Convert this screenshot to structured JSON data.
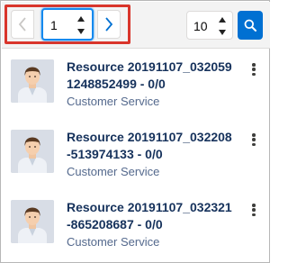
{
  "pagination": {
    "prev_icon": "chevron-left-icon",
    "next_icon": "chevron-right-icon",
    "current_page": "1",
    "page_size": "10",
    "search_icon": "search-icon"
  },
  "colors": {
    "highlight": "#d9352b",
    "brand": "#0070d2",
    "title": "#16325c",
    "subtitle": "#54698d"
  },
  "items": [
    {
      "title": "Resource 20191107_032059 1248852499 - 0/0",
      "subtitle": "Customer Service",
      "avatar_icon": "user-avatar-icon",
      "menu_icon": "kebab-menu-icon"
    },
    {
      "title": "Resource 20191107_032208 -513974133 - 0/0",
      "subtitle": "Customer Service",
      "avatar_icon": "user-avatar-icon",
      "menu_icon": "kebab-menu-icon"
    },
    {
      "title": "Resource 20191107_032321 -865208687 - 0/0",
      "subtitle": "Customer Service",
      "avatar_icon": "user-avatar-icon",
      "menu_icon": "kebab-menu-icon"
    }
  ]
}
